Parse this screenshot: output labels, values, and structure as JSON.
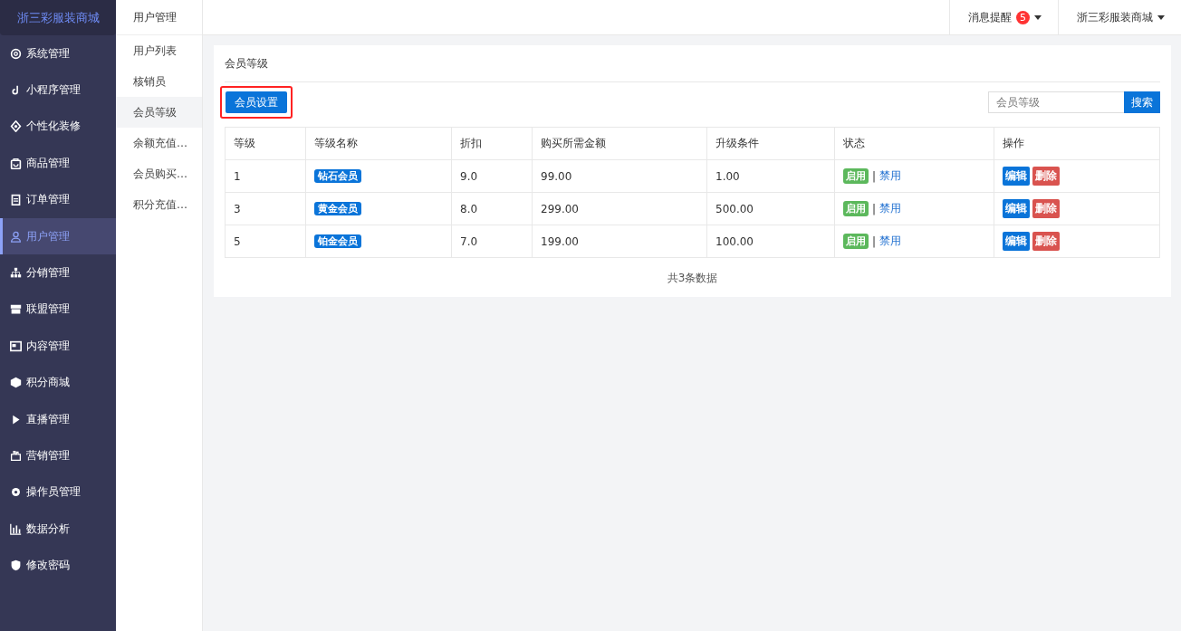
{
  "brand": "浙三彩服装商城",
  "sidebar": {
    "items": [
      {
        "label": "系统管理",
        "selected": false
      },
      {
        "label": "小程序管理",
        "selected": false
      },
      {
        "label": "个性化装修",
        "selected": false
      },
      {
        "label": "商品管理",
        "selected": false
      },
      {
        "label": "订单管理",
        "selected": false
      },
      {
        "label": "用户管理",
        "selected": true
      },
      {
        "label": "分销管理",
        "selected": false
      },
      {
        "label": "联盟管理",
        "selected": false
      },
      {
        "label": "内容管理",
        "selected": false
      },
      {
        "label": "积分商城",
        "selected": false
      },
      {
        "label": "直播管理",
        "selected": false
      },
      {
        "label": "营销管理",
        "selected": false
      },
      {
        "label": "操作员管理",
        "selected": false
      },
      {
        "label": "数据分析",
        "selected": false
      },
      {
        "label": "修改密码",
        "selected": false
      }
    ]
  },
  "submenu": {
    "title": "用户管理",
    "items": [
      {
        "label": "用户列表",
        "selected": false
      },
      {
        "label": "核销员",
        "selected": false
      },
      {
        "label": "会员等级",
        "selected": true
      },
      {
        "label": "余额充值…",
        "selected": false
      },
      {
        "label": "会员购买…",
        "selected": false
      },
      {
        "label": "积分充值…",
        "selected": false
      }
    ]
  },
  "topbar": {
    "notifications": {
      "label": "消息提醒",
      "count": "5"
    },
    "account": "浙三彩服装商城"
  },
  "panel": {
    "title": "会员等级",
    "settings_button": {
      "label": "会员设置",
      "highlighted": true
    },
    "search": {
      "placeholder": "会员等级",
      "button": "搜索"
    },
    "table": {
      "columns": [
        "等级",
        "等级名称",
        "折扣",
        "购买所需金额",
        "升级条件",
        "状态",
        "操作"
      ],
      "rows": [
        {
          "level": "1",
          "name": "钻石会员",
          "discount": "9.0",
          "price": "99.00",
          "condition": "1.00",
          "enabled": true,
          "enable_label": "启用",
          "separator": "|",
          "disable_label": "禁用",
          "edit": "编辑",
          "delete": "删除"
        },
        {
          "level": "3",
          "name": "黄金会员",
          "discount": "8.0",
          "price": "299.00",
          "condition": "500.00",
          "enabled": true,
          "enable_label": "启用",
          "separator": "|",
          "disable_label": "禁用",
          "edit": "编辑",
          "delete": "删除"
        },
        {
          "level": "5",
          "name": "铂金会员",
          "discount": "7.0",
          "price": "199.00",
          "condition": "100.00",
          "enabled": true,
          "enable_label": "启用",
          "separator": "|",
          "disable_label": "禁用",
          "edit": "编辑",
          "delete": "删除"
        }
      ]
    },
    "footer": "共3条数据"
  }
}
